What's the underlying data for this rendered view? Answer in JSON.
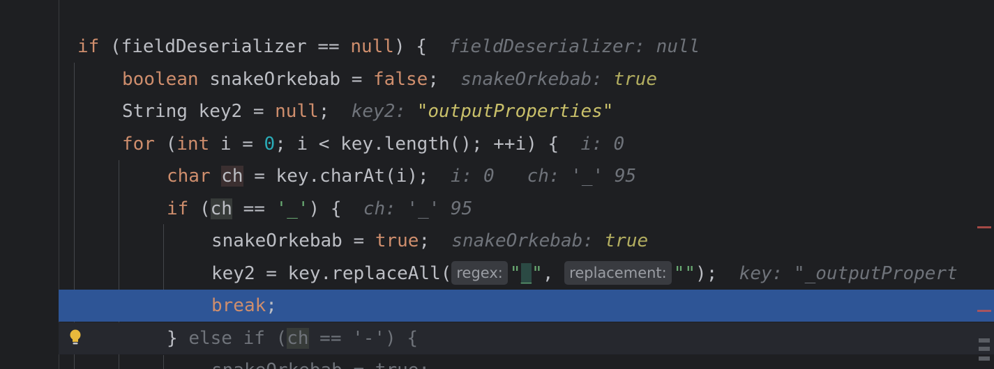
{
  "editor": {
    "lines": [
      {
        "code_a": "if",
        "code_b": " (fieldDeserializer == ",
        "code_c": "null",
        "code_d": ") {",
        "hint_label": "fieldDeserializer: null"
      },
      {
        "kw": "boolean",
        "code": " snakeOrkebab = ",
        "val": "false",
        "end": ";",
        "hint_label": "snakeOrkebab:",
        "hint_value": "true"
      },
      {
        "code": "String key2 = ",
        "val": "null",
        "end": ";",
        "hint_label": "key2:",
        "hint_value": "\"outputProperties\""
      },
      {
        "kw": "for",
        "code_a": " (",
        "kw2": "int",
        "code_b": " i = ",
        "num": "0",
        "code_c": "; i < key.length(); ++i) {",
        "hint_label": "i: 0"
      },
      {
        "kw": "char",
        "ch": "ch",
        "code": " = key.charAt(i);",
        "hint_label_1": "i: 0",
        "hint_label_2": "ch: '_' 95"
      },
      {
        "kw": "if",
        "code_a": " (",
        "ch": "ch",
        "code_b": " == ",
        "str": "'_'",
        "code_c": ") {",
        "hint_label": "ch: '_' 95"
      },
      {
        "code": "snakeOrkebab = ",
        "val": "true",
        "end": ";",
        "hint_label": "snakeOrkebab:",
        "hint_value": "true"
      },
      {
        "code_a": "key2 = key.replaceAll(",
        "param1": "regex:",
        "str1a": "\"",
        "str1b": "_",
        "str1c": "\"",
        "sep": ", ",
        "param2": "replacement:",
        "str2": "\"\"",
        "code_b": ");",
        "hint_label": "key: \"_outputPropert"
      },
      {
        "kw": "break",
        "end": ";"
      },
      {
        "code_a": "} ",
        "kw": "else if",
        "code_b": " (",
        "ch": "ch",
        "code_c": " == '-') {"
      },
      {
        "code": "snakeOrkebab = true;"
      }
    ]
  },
  "colors": {
    "background": "#1e1f22",
    "keyword": "#cf8e6d",
    "number": "#2aacb8",
    "string": "#6aab73",
    "hint": "#6f737a",
    "current_line": "#2e5596"
  },
  "icons": {
    "bulb": "lightbulb-icon"
  }
}
